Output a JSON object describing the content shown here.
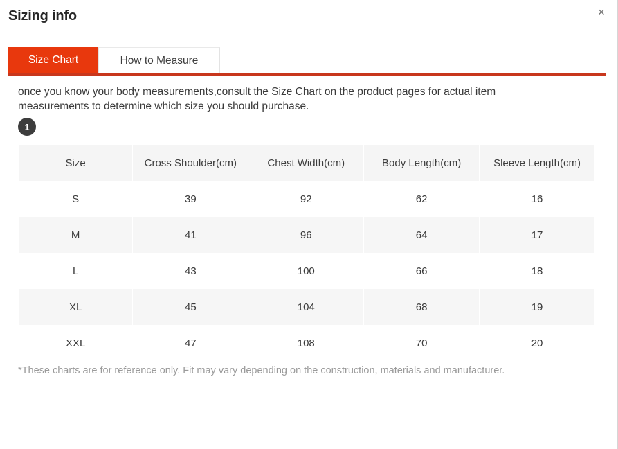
{
  "dialog": {
    "title": "Sizing info",
    "close_label": "×",
    "close_icon": "close-icon"
  },
  "tabs": [
    {
      "label": "Size Chart",
      "active": true
    },
    {
      "label": "How to Measure",
      "active": false
    }
  ],
  "content": {
    "description": "once you know your body measurements,consult the Size Chart on the product pages for actual item measurements to determine which size you should purchase.",
    "step_badge": "1",
    "footnote": "*These charts are for reference only. Fit may vary depending on the construction, materials and manufacturer."
  },
  "chart_data": {
    "type": "table",
    "title": "Size Chart",
    "columns": [
      "Size",
      "Cross Shoulder(cm)",
      "Chest Width(cm)",
      "Body Length(cm)",
      "Sleeve Length(cm)"
    ],
    "rows": [
      [
        "S",
        "39",
        "92",
        "62",
        "16"
      ],
      [
        "M",
        "41",
        "96",
        "64",
        "17"
      ],
      [
        "L",
        "43",
        "100",
        "66",
        "18"
      ],
      [
        "XL",
        "45",
        "104",
        "68",
        "19"
      ],
      [
        "XXL",
        "47",
        "108",
        "70",
        "20"
      ]
    ]
  },
  "colors": {
    "accent": "#e8380d",
    "accent_border": "#c8371d",
    "header_bg": "#f5f5f5",
    "stripe_bg": "#f6f6f6",
    "badge_bg": "#3d3d3d",
    "muted_text": "#9a9a9a"
  }
}
